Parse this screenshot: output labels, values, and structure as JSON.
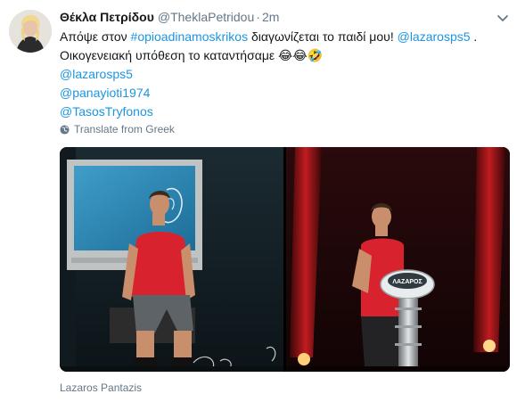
{
  "tweet": {
    "author_name": "Θέκλα Πετρίδου",
    "author_handle": "@TheklaPetridou",
    "separator": "·",
    "time": "2m",
    "text": {
      "line1_pre": "Απόψε στον ",
      "line1_hashtag": "#opioadinamoskrikos",
      "line1_mid": " διαγωνίζεται το παιδί μου! ",
      "line1_mention": "@lazarosps5",
      "line1_post": " .",
      "line2_text": "Οικογενειακή υπόθεση το καταντήσαμε ",
      "line2_emoji": "😂😂🤣",
      "mention2": "@lazarosps5",
      "mention3": "@panayioti1974",
      "mention4": "@TasosTryfonos"
    },
    "translate_label": "Translate from Greek",
    "media_credit": "Lazaros Pantazis",
    "podium_label": "ΛΑΖΑΡΟΣ"
  },
  "icons": {
    "avatar": "user-avatar",
    "caret": "chevron-down-icon",
    "translate": "globe-icon"
  },
  "colors": {
    "link": "#1b95e0",
    "secondary_text": "#657786",
    "primary_text": "#14171a",
    "shirt_red": "#d8232f"
  }
}
